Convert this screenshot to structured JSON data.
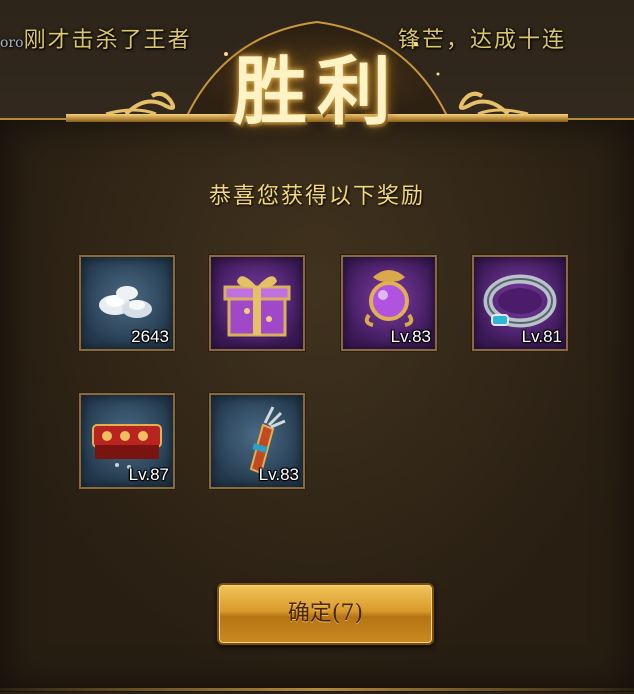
{
  "ticker": {
    "prefix": "oro",
    "left_text": "刚才击杀了王者",
    "right_text": "锋芒，达成十连"
  },
  "dialog": {
    "title": "胜利",
    "subtitle": "恭喜您获得以下奖励",
    "confirm_label": "确定(7)"
  },
  "rewards": [
    {
      "icon": "silver-ingot-icon",
      "label": "2643",
      "rarity": "blue"
    },
    {
      "icon": "gift-box-icon",
      "label": "",
      "rarity": "purple"
    },
    {
      "icon": "orb-amulet-icon",
      "label": "Lv.83",
      "rarity": "purple"
    },
    {
      "icon": "ring-icon",
      "label": "Lv.81",
      "rarity": "purple"
    },
    {
      "icon": "belt-icon",
      "label": "Lv.87",
      "rarity": "blue"
    },
    {
      "icon": "bracer-icon",
      "label": "Lv.83",
      "rarity": "blue"
    }
  ],
  "colors": {
    "title_gold": "#fff2c4",
    "subtitle_gold": "#f4d97a",
    "button_gold": "#d99a2a",
    "frame_gold": "#b58a3b",
    "purple_slot": "#7a3aa0",
    "blue_slot": "#4a6a84"
  }
}
